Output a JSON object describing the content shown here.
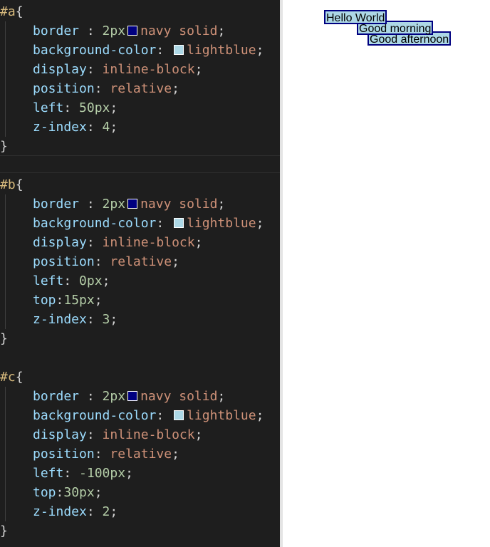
{
  "colors": {
    "editor_bg": "#1e1e1e",
    "selector": "#d7ba7d",
    "property": "#9cdcfe",
    "number": "#b5cea8",
    "string_value": "#ce9178",
    "navy": "#000080",
    "lightblue": "#add8e6"
  },
  "rules": [
    {
      "selector": "#a",
      "open": "{",
      "close": "}",
      "decls": [
        {
          "prop": "border",
          "sep": " : ",
          "num": "2px",
          "swatch_color": "#000080",
          "val": "navy solid",
          "semi": ";"
        },
        {
          "prop": "background-color",
          "sep": ": ",
          "swatch_color": "#add8e6",
          "val": "lightblue",
          "semi": ";"
        },
        {
          "prop": "display",
          "sep": ": ",
          "val": "inline-block",
          "semi": ";"
        },
        {
          "prop": "position",
          "sep": ": ",
          "val": "relative",
          "semi": ";"
        },
        {
          "prop": "left",
          "sep": ": ",
          "num": "50px",
          "semi": ";"
        },
        {
          "prop": "z-index",
          "sep": ": ",
          "num": "4",
          "semi": ";"
        }
      ]
    },
    {
      "selector": "#b",
      "open": "{",
      "close": "}",
      "decls": [
        {
          "prop": "border",
          "sep": " : ",
          "num": "2px",
          "swatch_color": "#000080",
          "val": "navy solid",
          "semi": ";"
        },
        {
          "prop": "background-color",
          "sep": ": ",
          "swatch_color": "#add8e6",
          "val": "lightblue",
          "semi": ";"
        },
        {
          "prop": "display",
          "sep": ": ",
          "val": "inline-block",
          "semi": ";"
        },
        {
          "prop": "position",
          "sep": ": ",
          "val": "relative",
          "semi": ";"
        },
        {
          "prop": "left",
          "sep": ": ",
          "num": "0px",
          "semi": ";"
        },
        {
          "prop": "top",
          "sep": ":",
          "num": "15px",
          "semi": ";"
        },
        {
          "prop": "z-index",
          "sep": ": ",
          "num": "3",
          "semi": ";"
        }
      ]
    },
    {
      "selector": "#c",
      "open": "{",
      "close": "}",
      "decls": [
        {
          "prop": "border",
          "sep": " : ",
          "num": "2px",
          "swatch_color": "#000080",
          "val": "navy solid",
          "semi": ";"
        },
        {
          "prop": "background-color",
          "sep": ": ",
          "swatch_color": "#add8e6",
          "val": "lightblue",
          "semi": ";"
        },
        {
          "prop": "display",
          "sep": ": ",
          "val": "inline-block",
          "semi": ";"
        },
        {
          "prop": "position",
          "sep": ": ",
          "val": "relative",
          "semi": ";"
        },
        {
          "prop": "left",
          "sep": ": ",
          "num": "-100px",
          "semi": ";"
        },
        {
          "prop": "top",
          "sep": ":",
          "num": "30px",
          "semi": ";"
        },
        {
          "prop": "z-index",
          "sep": ": ",
          "num": "2",
          "semi": ";"
        }
      ]
    }
  ],
  "preview": {
    "boxes": [
      {
        "id": "a",
        "text": "Hello World"
      },
      {
        "id": "b",
        "text": "Good morning"
      },
      {
        "id": "c",
        "text": "Good afternoon"
      }
    ]
  }
}
